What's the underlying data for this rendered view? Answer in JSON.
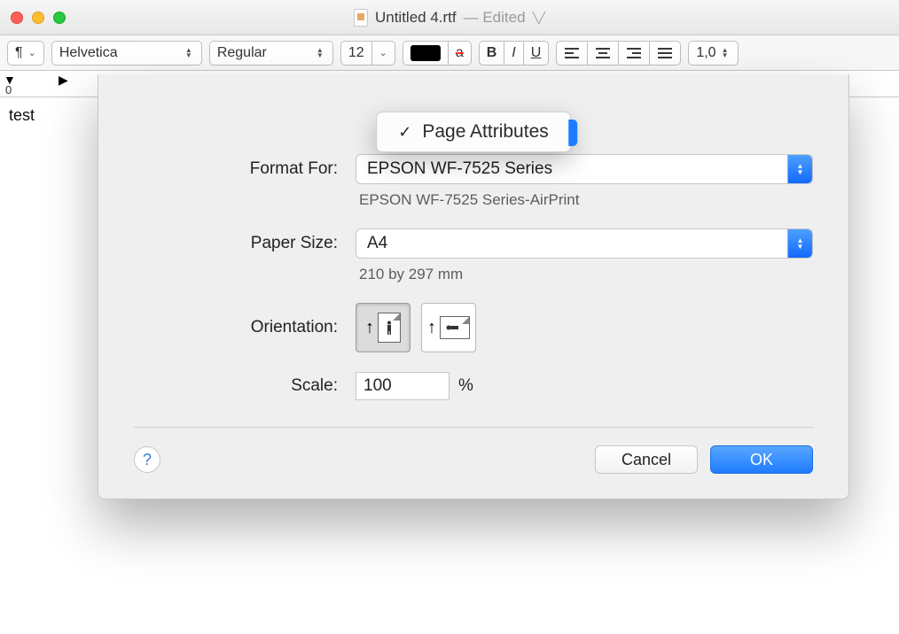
{
  "titlebar": {
    "filename": "Untitled 4.rtf",
    "edited": "— Edited"
  },
  "toolbar": {
    "paragraph_symbol": "¶",
    "font_family": "Helvetica",
    "font_style": "Regular",
    "font_size": "12",
    "strike_sample": "a",
    "bold": "B",
    "italic": "I",
    "underline": "U",
    "line_spacing": "1,0"
  },
  "ruler": {
    "zero": "0"
  },
  "document": {
    "text": "test"
  },
  "dialog": {
    "popover_label": "Page Attributes",
    "labels": {
      "format_for": "Format For:",
      "paper_size": "Paper Size:",
      "orientation": "Orientation:",
      "scale": "Scale:"
    },
    "format_for_value": "EPSON WF-7525 Series",
    "format_for_sub": "EPSON WF-7525 Series-AirPrint",
    "paper_size_value": "A4",
    "paper_size_sub": "210 by 297 mm",
    "scale_value": "100",
    "percent": "%",
    "cancel": "Cancel",
    "ok": "OK",
    "help": "?"
  }
}
